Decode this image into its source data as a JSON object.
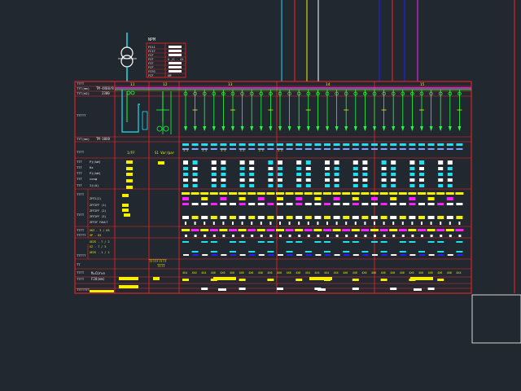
{
  "colors": {
    "background": "#212830",
    "frame": "#ff2020",
    "cyan": "#20e0f0",
    "yellow": "#f5f000",
    "white": "#ffffff",
    "green": "#20ff40",
    "magenta": "#ff20ff",
    "blue": "#2020ff",
    "olive": "#c8c800",
    "text": "#e8e8e8",
    "light_blue": "#7fa0ff"
  },
  "legend_table": {
    "title": "NPM",
    "rows": [
      {
        "label": "FS11",
        "value": ""
      },
      {
        "label": "FC17",
        "value": ""
      },
      {
        "label": "FCF",
        "value": ""
      },
      {
        "label": "FCF",
        "value": "A /C - 41"
      },
      {
        "label": "FCF",
        "value": ""
      },
      {
        "label": "FCF",
        "value": ""
      },
      {
        "label": "FCFG",
        "value": ""
      },
      {
        "label": "FCF",
        "value": "GM"
      }
    ]
  },
  "sections": [
    "11",
    "12",
    "13",
    "14",
    "15"
  ],
  "row_labels": {
    "r1": "TTTT",
    "r2": "TTT(mm)",
    "r3": "TTT(m2)",
    "r4": "TTTTT",
    "r5": "TTT(mm)",
    "r6": "TTTT",
    "r7": "TTT",
    "r8": "TTT",
    "r9": "TTT",
    "r10": "TTT",
    "r11": "TTT",
    "r12": "TTTT",
    "r13": "TTTT",
    "r14": "TTTT",
    "r15": "TTTTT",
    "r16": "TT",
    "r17": "TTTT",
    "r18": "TTTT",
    "r19": "TTTTTTT"
  },
  "row_values": {
    "r2v": "TM-4X60/8",
    "r3v": "2300",
    "r5v": "TM-10X8",
    "r7": "Pj(kW)",
    "r8": "Kx",
    "r9": "Pj(kW)",
    "r10": "cosφ",
    "r11": "Ij(A)"
  },
  "sublabels": [
    "ZFF2(2)",
    "ZFF2FF  (1)",
    "ZFF2FF  (2)",
    "ZFF2FF  (3)",
    "ZFF2F FAULT",
    "XKZ - 3 / 63",
    "XP - 63",
    "XEZS - 7 / 2",
    "XZ - 7 / 5",
    "XEZS - 1 / 2"
  ],
  "panel_labels": {
    "p1": "1/FF",
    "p2": "S1 Var/par",
    "p3": "TTTTTTTTT",
    "p4": "TTTT"
  },
  "bottom_values": {
    "v1": "M=CUrve",
    "v2": "F20(mm)"
  },
  "cable_codes": [
    "4X4",
    "4X4",
    "4X4",
    "4X6",
    "4X6",
    "4X6",
    "4X6",
    "4X6",
    "4X6",
    "4X6",
    "4X6",
    "4X6",
    "4X6",
    "4X4",
    "4X4",
    "4X4",
    "4X4",
    "4X6",
    "4X6",
    "4X6",
    "4X6",
    "4X6",
    "4X6",
    "4X6",
    "4X6",
    "4X6",
    "4X6",
    "4X6",
    "4X6"
  ],
  "circuit_labels": [
    "3 3",
    "3 3",
    "3 3",
    "3 3",
    "3 3",
    "3 3",
    "3 3",
    "3 3",
    "3 3",
    "3 3",
    "3 3",
    "3 3"
  ]
}
